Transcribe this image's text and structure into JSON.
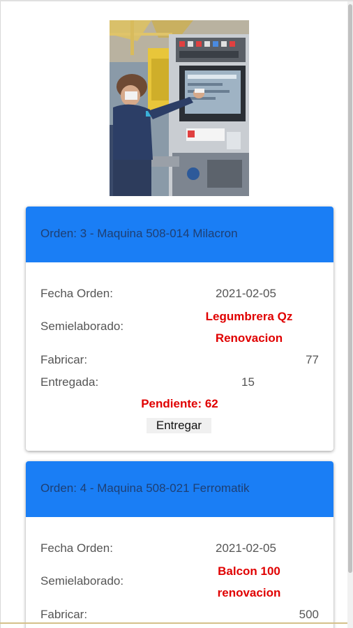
{
  "photo": {
    "description_icon": "operator-at-machine-photo"
  },
  "orders": [
    {
      "header": "Orden: 3 - Maquina 508-014 Milacron",
      "fecha_label": "Fecha Orden:",
      "fecha_value": "2021-02-05",
      "semi_label": "Semielaborado:",
      "semi_value_line1": "Legumbrera Qz",
      "semi_value_line2": "Renovacion",
      "fabricar_label": "Fabricar:",
      "fabricar_value": "77",
      "entregada_label": "Entregada:",
      "entregada_value": "15",
      "pendiente": "Pendiente: 62",
      "button_label": "Entregar"
    },
    {
      "header": "Orden: 4 - Maquina 508-021 Ferromatik",
      "fecha_label": "Fecha Orden:",
      "fecha_value": "2021-02-05",
      "semi_label": "Semielaborado:",
      "semi_value_line1": "Balcon 100",
      "semi_value_line2": "renovacion",
      "fabricar_label": "Fabricar:",
      "fabricar_value": "500"
    }
  ],
  "colors": {
    "header_bg": "#1a7ef5",
    "header_text": "#1e3f73",
    "highlight_red": "#e00000",
    "label_gray": "#555555"
  }
}
